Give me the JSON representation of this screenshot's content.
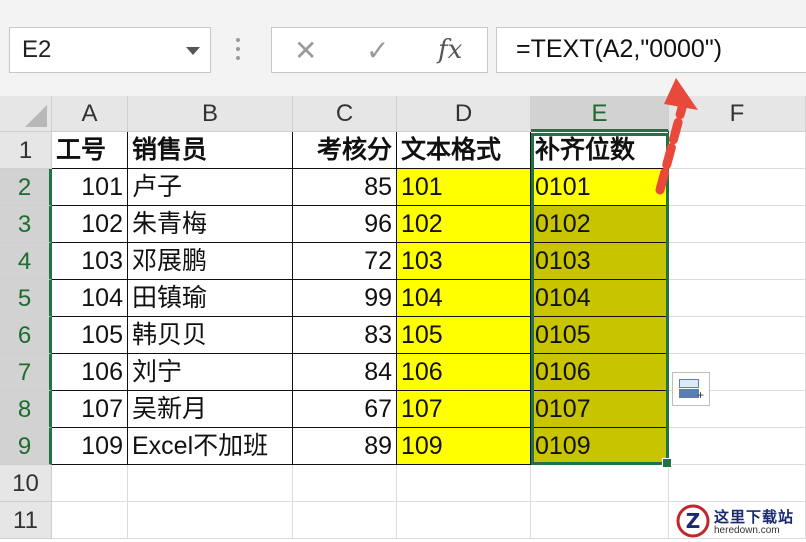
{
  "formula_bar": {
    "name_box": "E2",
    "cancel_glyph": "✕",
    "enter_glyph": "✓",
    "fx_label": "fx",
    "formula": "=TEXT(A2,\"0000\")"
  },
  "columns": [
    "A",
    "B",
    "C",
    "D",
    "E",
    "F"
  ],
  "rows": [
    "1",
    "2",
    "3",
    "4",
    "5",
    "6",
    "7",
    "8",
    "9",
    "10",
    "11"
  ],
  "table": {
    "headers": [
      "工号",
      "销售员",
      "考核分",
      "文本格式",
      "补齐位数"
    ],
    "records": [
      [
        "101",
        "卢子",
        "85",
        "101",
        "0101"
      ],
      [
        "102",
        "朱青梅",
        "96",
        "102",
        "0102"
      ],
      [
        "103",
        "邓展鹏",
        "72",
        "103",
        "0103"
      ],
      [
        "104",
        "田镇瑜",
        "99",
        "104",
        "0104"
      ],
      [
        "105",
        "韩贝贝",
        "83",
        "105",
        "0105"
      ],
      [
        "106",
        "刘宁",
        "84",
        "106",
        "0106"
      ],
      [
        "107",
        "吴新月",
        "67",
        "107",
        "0107"
      ],
      [
        "109",
        "Excel不加班",
        "89",
        "109",
        "0109"
      ]
    ]
  },
  "colors": {
    "selection": "#217346",
    "fill_d": "#ffff00",
    "fill_e": "#c8c400",
    "arrow": "#e8493a"
  },
  "icons": [
    "cancel-icon",
    "enter-icon",
    "fx-icon",
    "dropdown-icon",
    "quick-analysis-icon"
  ],
  "watermark": {
    "title": "这里下载站",
    "site": "heredown.com"
  }
}
